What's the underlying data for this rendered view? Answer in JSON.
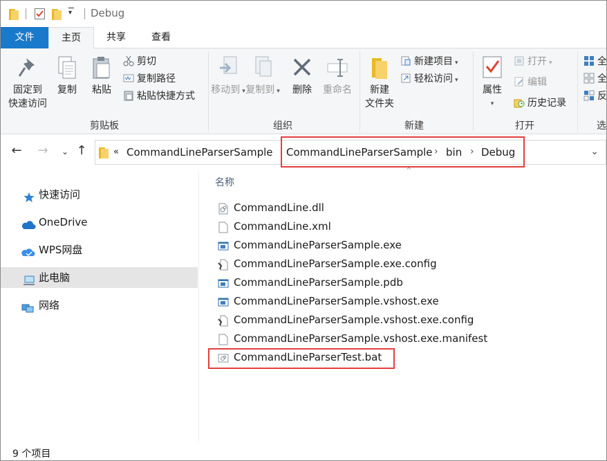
{
  "window": {
    "title": "Debug"
  },
  "tabs": [
    {
      "label": "文件"
    },
    {
      "label": "主页"
    },
    {
      "label": "共享"
    },
    {
      "label": "查看"
    }
  ],
  "ribbon": {
    "clipboard": {
      "group_label": "剪贴板",
      "pin_label_1": "固定到",
      "pin_label_2": "快速访问",
      "copy_label": "复制",
      "paste_label": "粘贴",
      "cut_label": "剪切",
      "copy_path_label": "复制路径",
      "paste_shortcut_label": "粘贴快捷方式"
    },
    "organize": {
      "group_label": "组织",
      "move_to_label": "移动到",
      "copy_to_label": "复制到",
      "delete_label": "删除",
      "rename_label": "重命名"
    },
    "new": {
      "group_label": "新建",
      "new_folder_label_1": "新建",
      "new_folder_label_2": "文件夹",
      "new_item_label": "新建项目",
      "easy_access_label": "轻松访问"
    },
    "open": {
      "group_label": "打开",
      "properties_label": "属性",
      "open_label": "打开",
      "edit_label": "编辑",
      "history_label": "历史记录"
    },
    "select": {
      "label_1": "全",
      "label_2": "全",
      "label_3": "反",
      "group_label_partial": "选"
    }
  },
  "address": {
    "overflow": "«",
    "crumbs": [
      "CommandLineParserSample",
      "CommandLineParserSample",
      "bin",
      "Debug"
    ]
  },
  "nav": {
    "items": [
      {
        "label": "快速访问"
      },
      {
        "label": "OneDrive"
      },
      {
        "label": "WPS网盘"
      },
      {
        "label": "此电脑"
      },
      {
        "label": "网络"
      }
    ]
  },
  "list": {
    "column_name": "名称",
    "files": [
      {
        "name": "CommandLine.dll",
        "icon": "dll-file-icon"
      },
      {
        "name": "CommandLine.xml",
        "icon": "blank-file-icon"
      },
      {
        "name": "CommandLineParserSample.exe",
        "icon": "exe-file-icon"
      },
      {
        "name": "CommandLineParserSample.exe.config",
        "icon": "config-file-icon"
      },
      {
        "name": "CommandLineParserSample.pdb",
        "icon": "exe-file-icon"
      },
      {
        "name": "CommandLineParserSample.vshost.exe",
        "icon": "exe-file-icon"
      },
      {
        "name": "CommandLineParserSample.vshost.exe.config",
        "icon": "config-file-icon"
      },
      {
        "name": "CommandLineParserSample.vshost.exe.manifest",
        "icon": "blank-file-icon"
      },
      {
        "name": "CommandLineParserTest.bat",
        "icon": "bat-file-icon"
      }
    ]
  },
  "status": {
    "count_text": "9 个项目"
  },
  "colors": {
    "accent": "#1979ca",
    "highlight_box": "#e43e3e",
    "folder": "#f7d26a"
  }
}
